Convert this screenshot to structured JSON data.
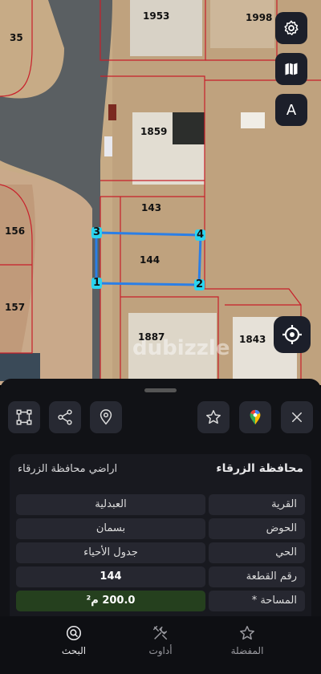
{
  "map": {
    "plots": [
      {
        "id": "p35",
        "label": "35"
      },
      {
        "id": "p1953",
        "label": "1953"
      },
      {
        "id": "p1998",
        "label": "1998"
      },
      {
        "id": "p1859",
        "label": "1859"
      },
      {
        "id": "p143",
        "label": "143"
      },
      {
        "id": "p144",
        "label": "144"
      },
      {
        "id": "p156",
        "label": "156"
      },
      {
        "id": "p157",
        "label": "157"
      },
      {
        "id": "p1887",
        "label": "1887"
      },
      {
        "id": "p1843",
        "label": "1843"
      }
    ],
    "vertices": [
      "1",
      "2",
      "3",
      "4"
    ],
    "watermark": "dubizzle",
    "compass_label": "A"
  },
  "toolbar": {
    "icons": [
      "polygon-icon",
      "share-icon",
      "location-pin-icon",
      "star-icon",
      "google-maps-icon",
      "close-icon"
    ]
  },
  "parcel": {
    "governorate_title": "محافظة الزرقاء",
    "subtitle": "اراضي محافظة الزرقاء",
    "rows": [
      {
        "label": "القرية",
        "value": "العبدلية"
      },
      {
        "label": "الحوض",
        "value": "بسمان"
      },
      {
        "label": "الحي",
        "value": "جدول الأحياء"
      },
      {
        "label": "رقم القطعة",
        "value": "144"
      },
      {
        "label": "المساحة *",
        "value": "200.0 م²"
      }
    ]
  },
  "nav": {
    "favorites": "المفضلة",
    "tools": "أداوت",
    "search": "البحث"
  },
  "colors": {
    "accent_blue": "#2b7fe6",
    "vertex_cyan": "#2ad4f0",
    "area_green": "#25401e"
  }
}
